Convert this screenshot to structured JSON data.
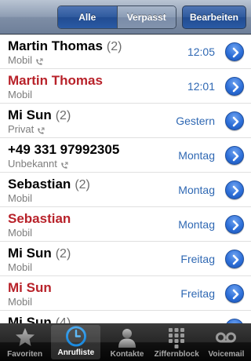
{
  "navbar": {
    "segments": [
      "Alle",
      "Verpasst"
    ],
    "selected_segment": "Alle",
    "edit_label": "Bearbeiten"
  },
  "calls": [
    {
      "name": "Martin Thomas",
      "count": "(2)",
      "type": "Mobil",
      "outgoing_icon": true,
      "time": "12:05",
      "missed": false
    },
    {
      "name": "Martin Thomas",
      "count": "",
      "type": "Mobil",
      "outgoing_icon": false,
      "time": "12:01",
      "missed": true
    },
    {
      "name": "Mi Sun",
      "count": "(2)",
      "type": "Privat",
      "outgoing_icon": true,
      "time": "Gestern",
      "missed": false
    },
    {
      "name": "+49 331 97992305",
      "count": "",
      "type": "Unbekannt",
      "outgoing_icon": true,
      "time": "Montag",
      "missed": false
    },
    {
      "name": "Sebastian",
      "count": "(2)",
      "type": "Mobil",
      "outgoing_icon": false,
      "time": "Montag",
      "missed": false
    },
    {
      "name": "Sebastian",
      "count": "",
      "type": "Mobil",
      "outgoing_icon": false,
      "time": "Montag",
      "missed": true
    },
    {
      "name": "Mi Sun",
      "count": "(2)",
      "type": "Mobil",
      "outgoing_icon": false,
      "time": "Freitag",
      "missed": false
    },
    {
      "name": "Mi Sun",
      "count": "",
      "type": "Mobil",
      "outgoing_icon": false,
      "time": "Freitag",
      "missed": true
    },
    {
      "name": "Mi Sun",
      "count": "(4)",
      "type": "",
      "outgoing_icon": false,
      "time": "",
      "missed": false
    }
  ],
  "tabbar": {
    "tabs": [
      {
        "label": "Favoriten",
        "icon": "star-icon",
        "active": false
      },
      {
        "label": "Anrufliste",
        "icon": "clock-icon",
        "active": true
      },
      {
        "label": "Kontakte",
        "icon": "contact-icon",
        "active": false
      },
      {
        "label": "Ziffernblock",
        "icon": "keypad-icon",
        "active": false
      },
      {
        "label": "Voicemail",
        "icon": "voicemail-icon",
        "active": false
      }
    ]
  },
  "colors": {
    "missed_red": "#b8222a",
    "time_blue": "#2f68b3",
    "secondary_gray": "#7d7d7d"
  }
}
